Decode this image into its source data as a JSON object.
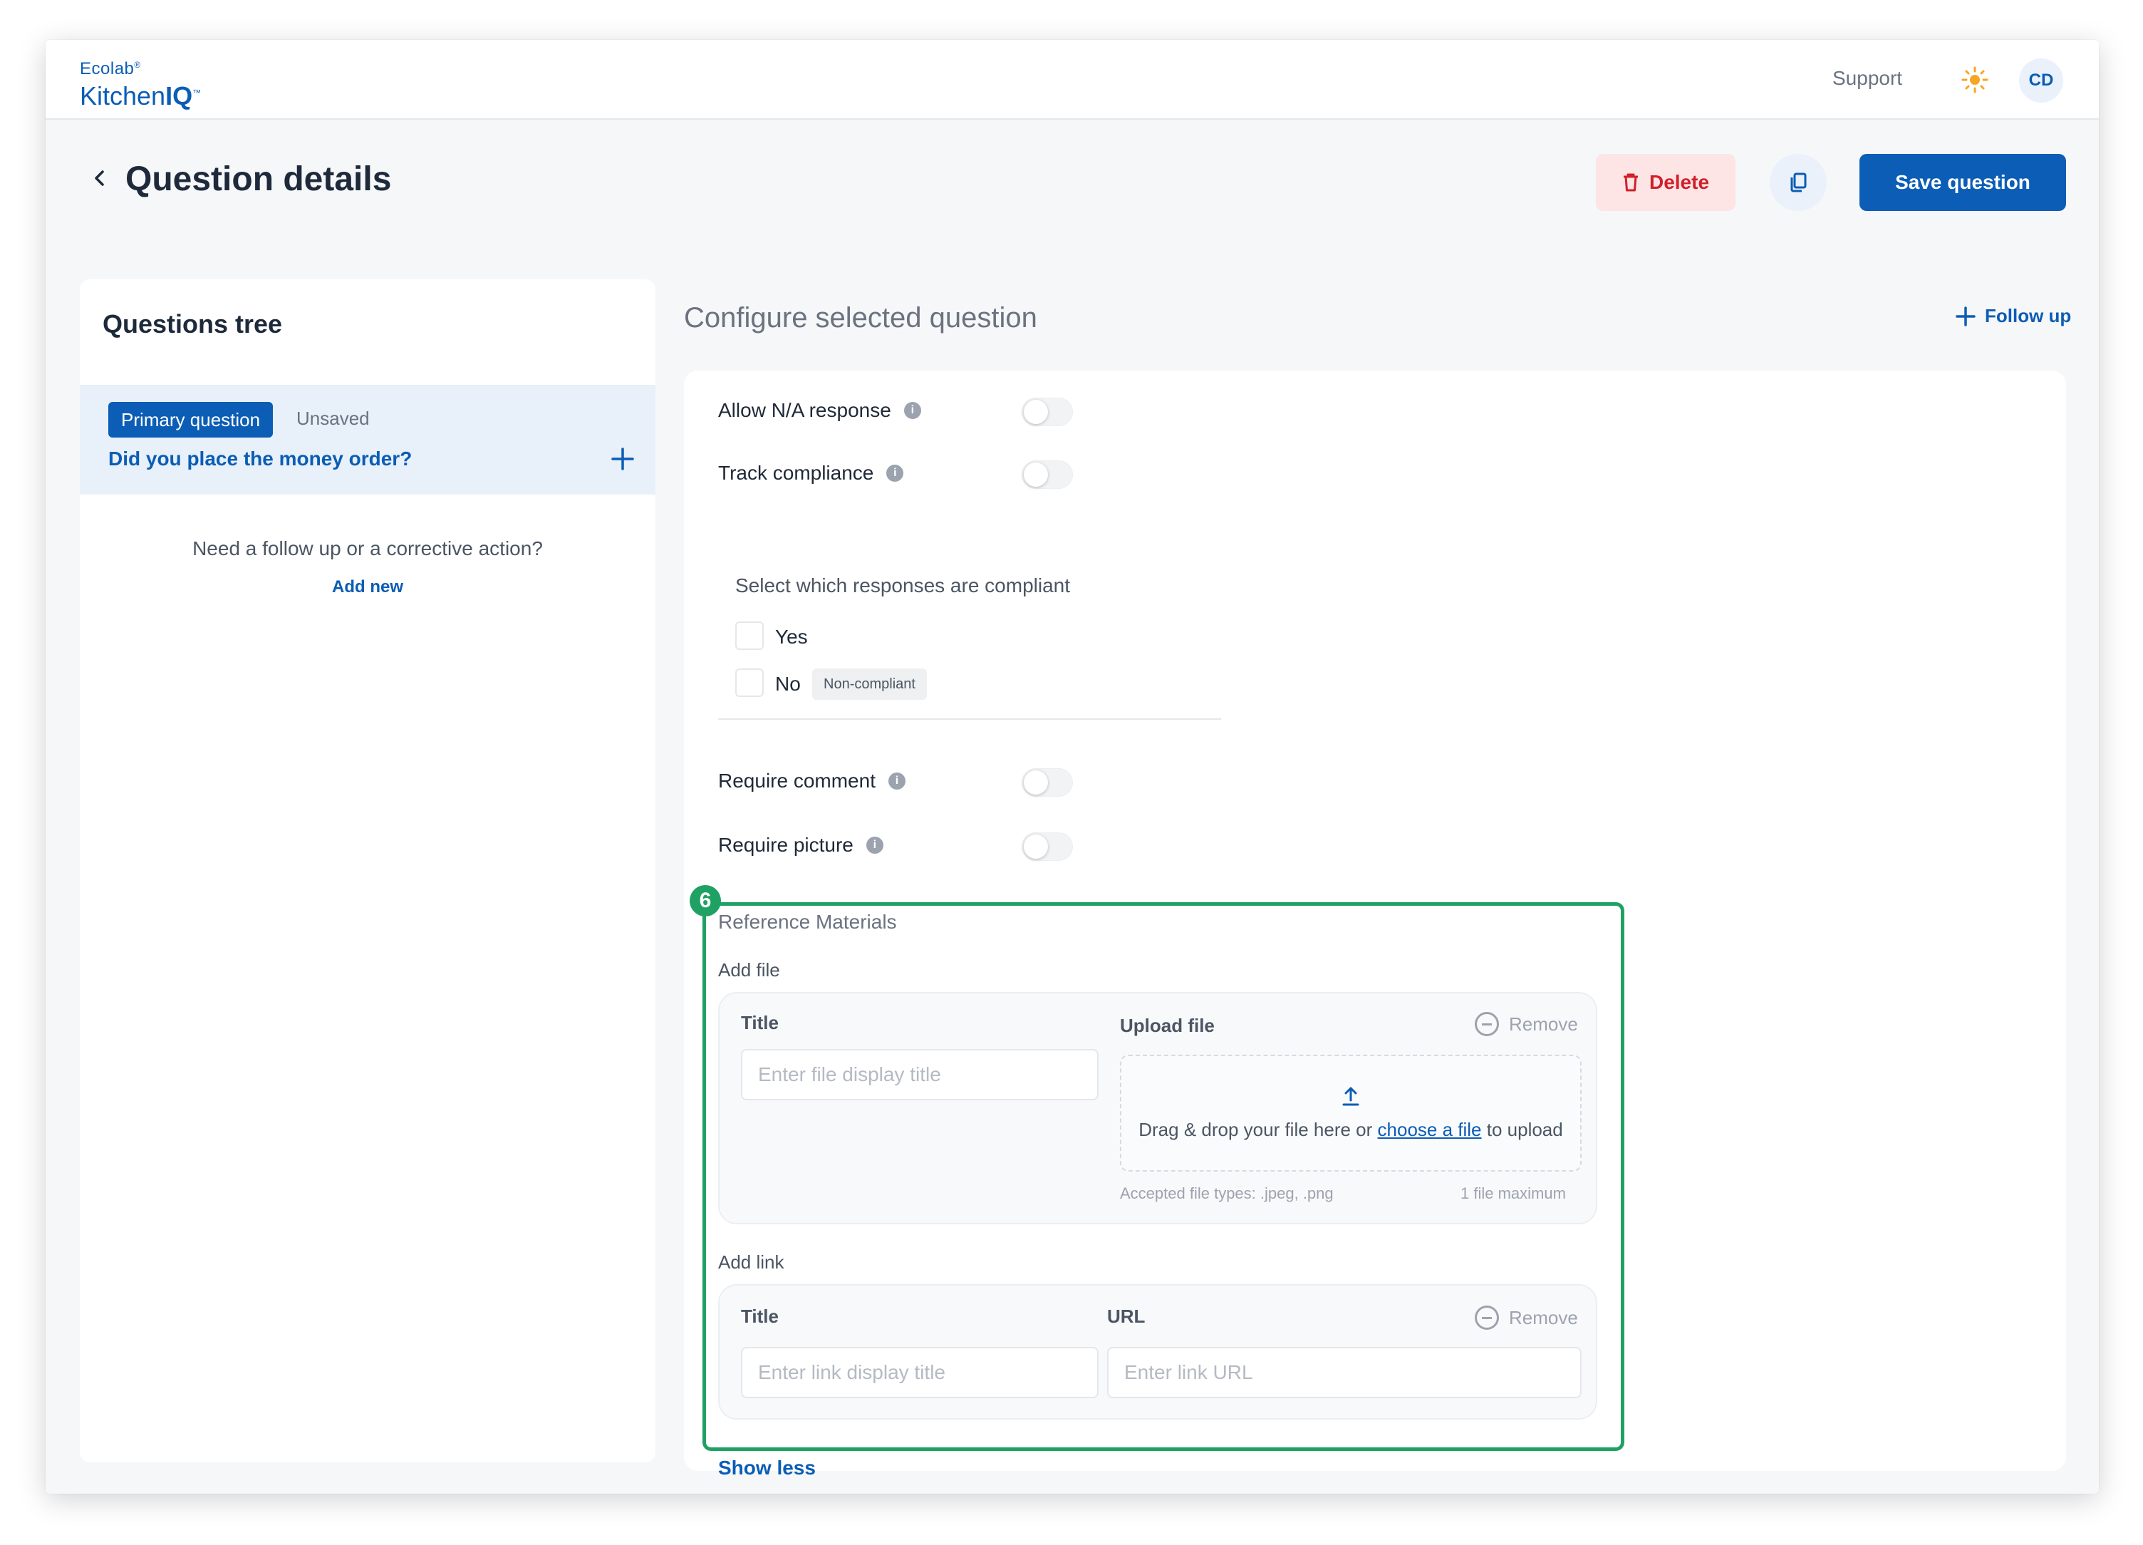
{
  "header": {
    "logo_brand": "Ecolab",
    "logo_product": "Kitchen",
    "logo_product_bold": "IQ",
    "support": "Support",
    "avatar_initials": "CD",
    "icons": {
      "theme": "sun-icon",
      "back": "chevron-left-icon",
      "delete": "trash-icon",
      "copy": "copy-icon"
    }
  },
  "page": {
    "title": "Question details",
    "delete_label": "Delete",
    "save_label": "Save question"
  },
  "tree": {
    "title": "Questions tree",
    "primary_badge": "Primary question",
    "status": "Unsaved",
    "question": "Did you place the money order?",
    "followup_prompt": "Need a follow up or a corrective action?",
    "add_new": "Add new"
  },
  "config": {
    "title": "Configure selected question",
    "follow_up": "Follow up",
    "allow_na": "Allow N/A response",
    "track_compliance": "Track compliance",
    "compliant_title": "Select which responses are compliant",
    "responses": [
      {
        "label": "Yes",
        "checked": false
      },
      {
        "label": "No",
        "checked": false,
        "tag": "Non-compliant"
      }
    ],
    "require_comment": "Require comment",
    "require_picture": "Require picture",
    "toggles": {
      "allow_na": false,
      "track_compliance": false,
      "require_comment": false,
      "require_picture": false
    },
    "show_less": "Show less"
  },
  "reference": {
    "step_number": "6",
    "highlight_color": "#1fa164",
    "title": "Reference Materials",
    "add_file": {
      "label": "Add file",
      "title_label": "Title",
      "title_placeholder": "Enter file display title",
      "upload_label": "Upload file",
      "remove": "Remove",
      "drop_text_before": "Drag & drop your file here or ",
      "drop_link": "choose a file",
      "drop_text_after": " to upload",
      "accepted": "Accepted file types: .jpeg, .png",
      "max": "1 file maximum"
    },
    "add_link": {
      "label": "Add link",
      "title_label": "Title",
      "title_placeholder": "Enter link display title",
      "url_label": "URL",
      "url_placeholder": "Enter link URL",
      "remove": "Remove"
    }
  },
  "colors": {
    "primary": "#0b5db5",
    "danger": "#d21f2b",
    "danger_bg": "#fde5e5",
    "highlight": "#1fa164"
  }
}
